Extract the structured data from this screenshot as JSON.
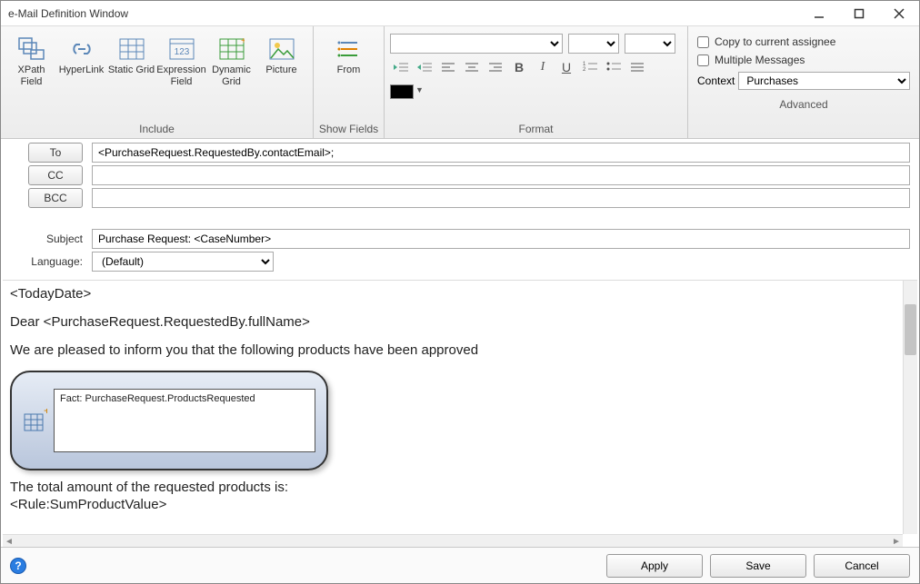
{
  "window": {
    "title": "e-Mail Definition Window"
  },
  "ribbon": {
    "include": {
      "label": "Include",
      "buttons": {
        "xpath_field": "XPath Field",
        "hyperlink": "HyperLink",
        "static_grid": "Static Grid",
        "expression_field": "Expression Field",
        "dynamic_grid": "Dynamic Grid",
        "picture": "Picture"
      }
    },
    "show_fields": {
      "label": "Show Fields",
      "from_btn": "From"
    },
    "format": {
      "label": "Format"
    },
    "advanced": {
      "label": "Advanced",
      "copy_to_assignee": "Copy to current assignee",
      "multiple_messages": "Multiple Messages",
      "context_label": "Context",
      "context_value": "Purchases"
    }
  },
  "fields": {
    "to_label": "To",
    "to_value": "<PurchaseRequest.RequestedBy.contactEmail>;",
    "cc_label": "CC",
    "cc_value": "",
    "bcc_label": "BCC",
    "bcc_value": "",
    "subject_label": "Subject",
    "subject_value": "Purchase Request: <CaseNumber>",
    "language_label": "Language:",
    "language_value": "(Default)"
  },
  "body": {
    "line1": "<TodayDate>",
    "line2": "Dear <PurchaseRequest.RequestedBy.fullName>",
    "line3": "We are pleased to inform you that the following products have been approved",
    "fact_label": "Fact: PurchaseRequest.ProductsRequested",
    "line4": "The total amount of the requested products is:",
    "line5": "<Rule:SumProductValue>"
  },
  "buttons": {
    "apply": "Apply",
    "save": "Save",
    "cancel": "Cancel"
  }
}
